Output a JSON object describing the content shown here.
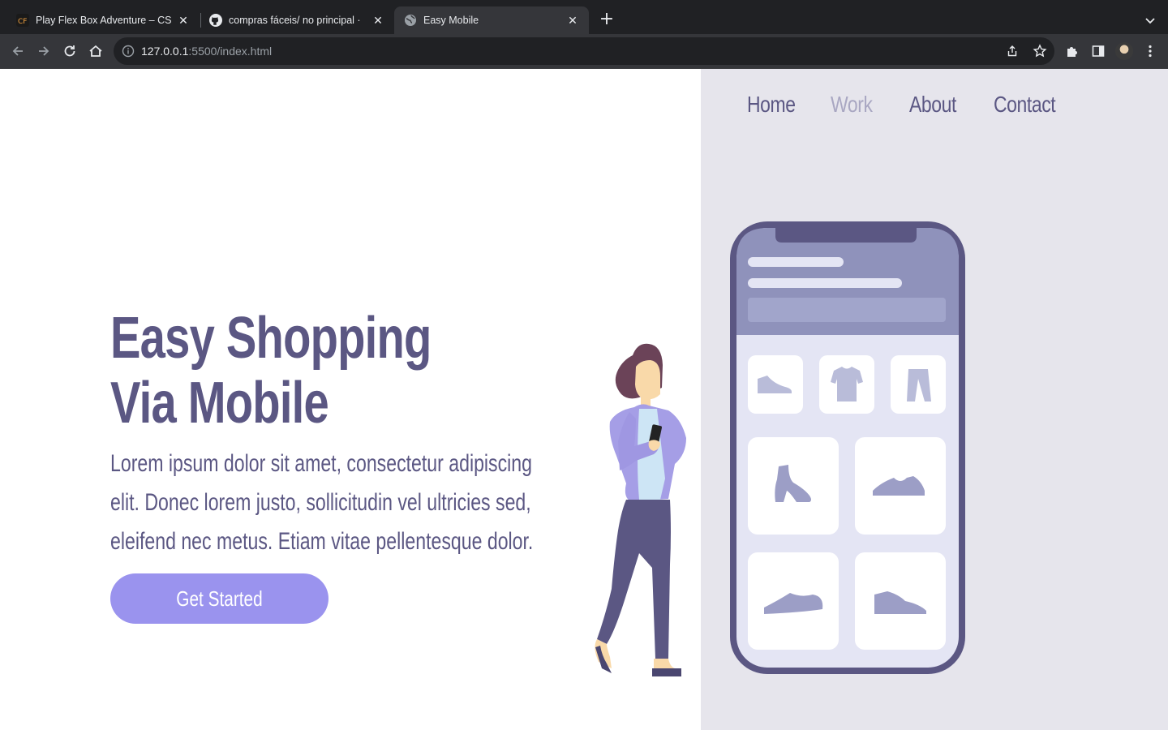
{
  "browser": {
    "tabs": [
      {
        "title": "Play Flex Box Adventure – CSS",
        "icon": "flexbox-adventure-favicon"
      },
      {
        "title": "compras fáceis/ no principal · ",
        "icon": "github-icon"
      },
      {
        "title": "Easy Mobile",
        "icon": "globe-icon",
        "active": true
      }
    ],
    "url_host": "127.0.0.1",
    "url_rest": ":5500/index.html"
  },
  "page": {
    "nav": [
      "Home",
      "Work",
      "About",
      "Contact"
    ],
    "active_nav": "Work",
    "hero_title_line1": "Easy Shopping",
    "hero_title_line2": "Via Mobile",
    "hero_text": "Lorem ipsum dolor sit amet, consectetur adipiscing elit. Donec lorem justo, sollicitudin vel ultricies sed, eleifend nec metus. Etiam vitae pellentesque dolor.",
    "cta_label": "Get Started"
  },
  "colors": {
    "brand": "#5b5783",
    "accent": "#9a93ee",
    "nav_muted": "#a9a7c2",
    "panel_bg": "#e6e5ec"
  }
}
